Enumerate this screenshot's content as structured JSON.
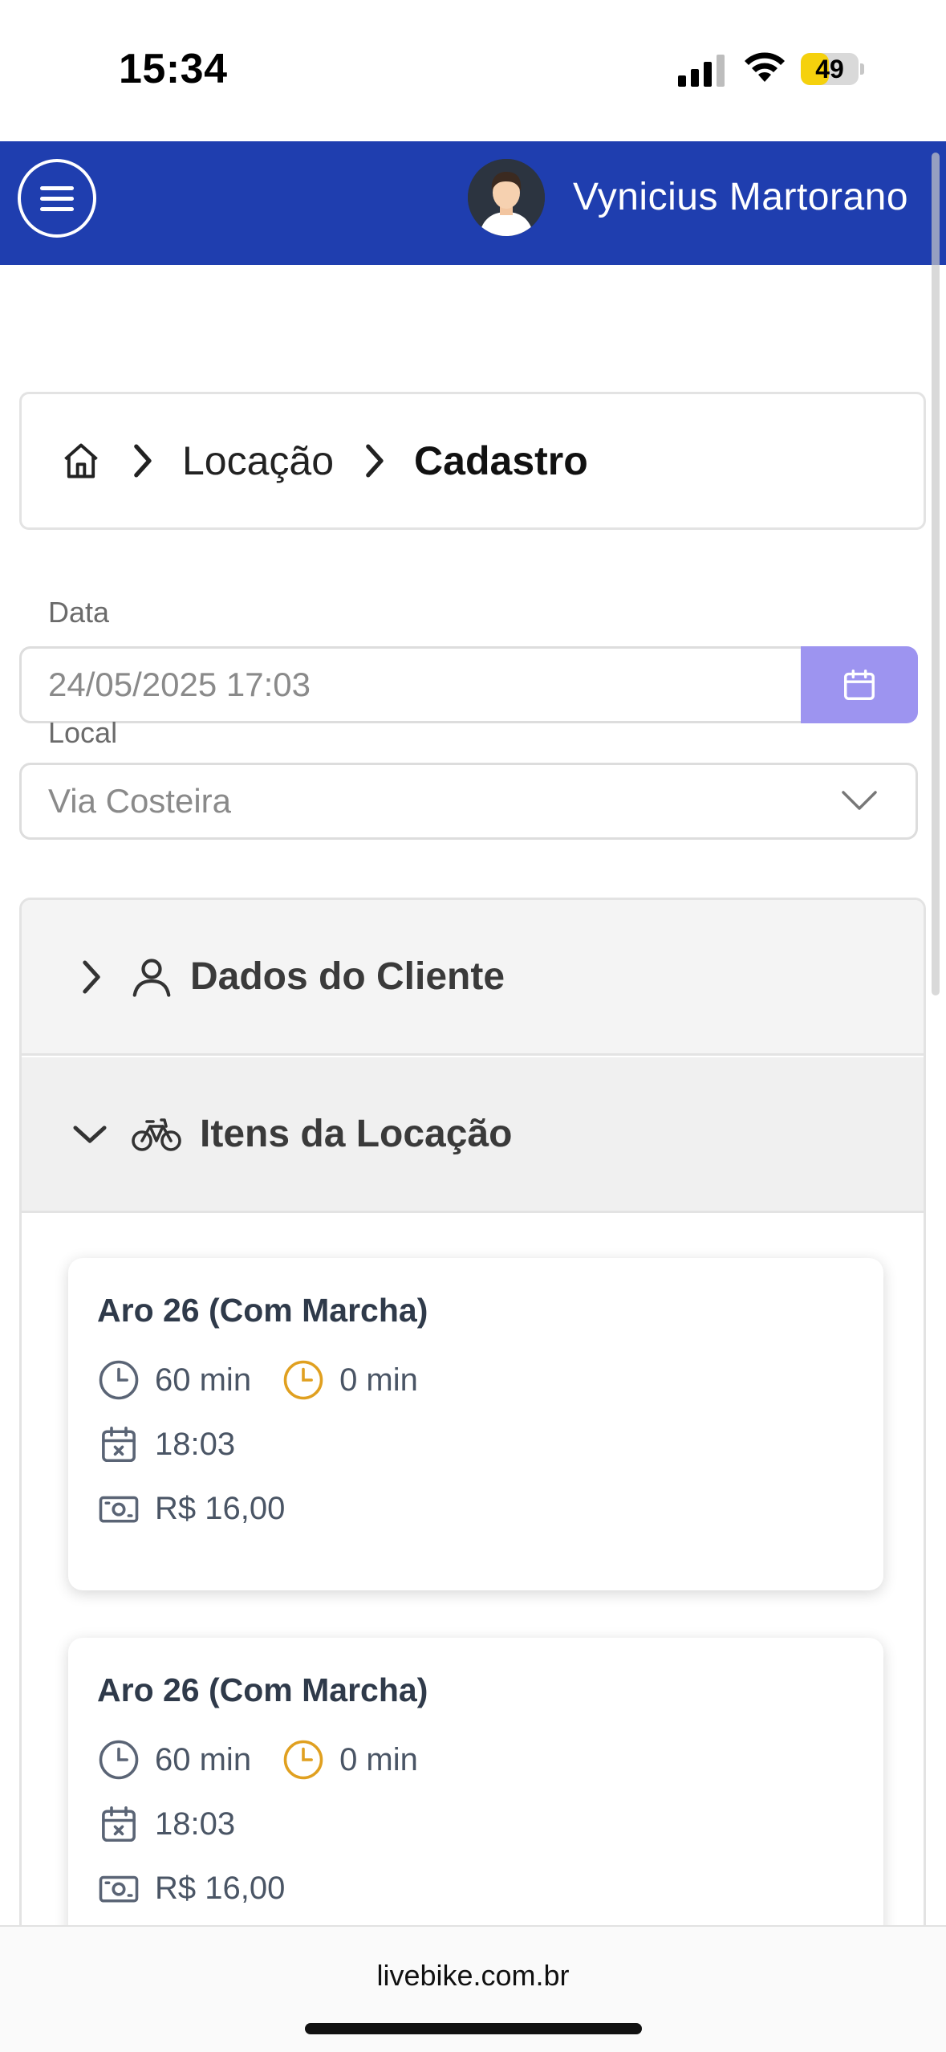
{
  "status_bar": {
    "time": "15:34",
    "battery": "49",
    "battery_level": 0.49
  },
  "header": {
    "user_name": "Vynicius Martorano",
    "menu_icon": "hamburger-menu-icon",
    "avatar_icon": "user-avatar"
  },
  "breadcrumb": {
    "home_icon": "home-icon",
    "items": [
      "Locação"
    ],
    "current": "Cadastro"
  },
  "form": {
    "date_label": "Data",
    "date_value": "24/05/2025 17:03",
    "local_label": "Local",
    "local_value": "Via Costeira"
  },
  "accordion": {
    "sections": [
      {
        "title": "Dados do Cliente",
        "icon": "user-icon",
        "expanded": false
      },
      {
        "title": "Itens da Locação",
        "icon": "bicycle-icon",
        "expanded": true
      }
    ]
  },
  "items": [
    {
      "name": "Aro 26 (Com Marcha)",
      "duration": "60 min",
      "extra": "0 min",
      "end_time": "18:03",
      "price": "R$ 16,00"
    },
    {
      "name": "Aro 26 (Com Marcha)",
      "duration": "60 min",
      "extra": "0 min",
      "end_time": "18:03",
      "price": "R$ 16,00"
    }
  ],
  "footer": {
    "url": "livebike.com.br"
  },
  "colors": {
    "header_bg": "#1f3eaf",
    "calendar_button": "#9d94f0",
    "clock_extra": "#e0a020",
    "battery": "#f5d10d"
  }
}
